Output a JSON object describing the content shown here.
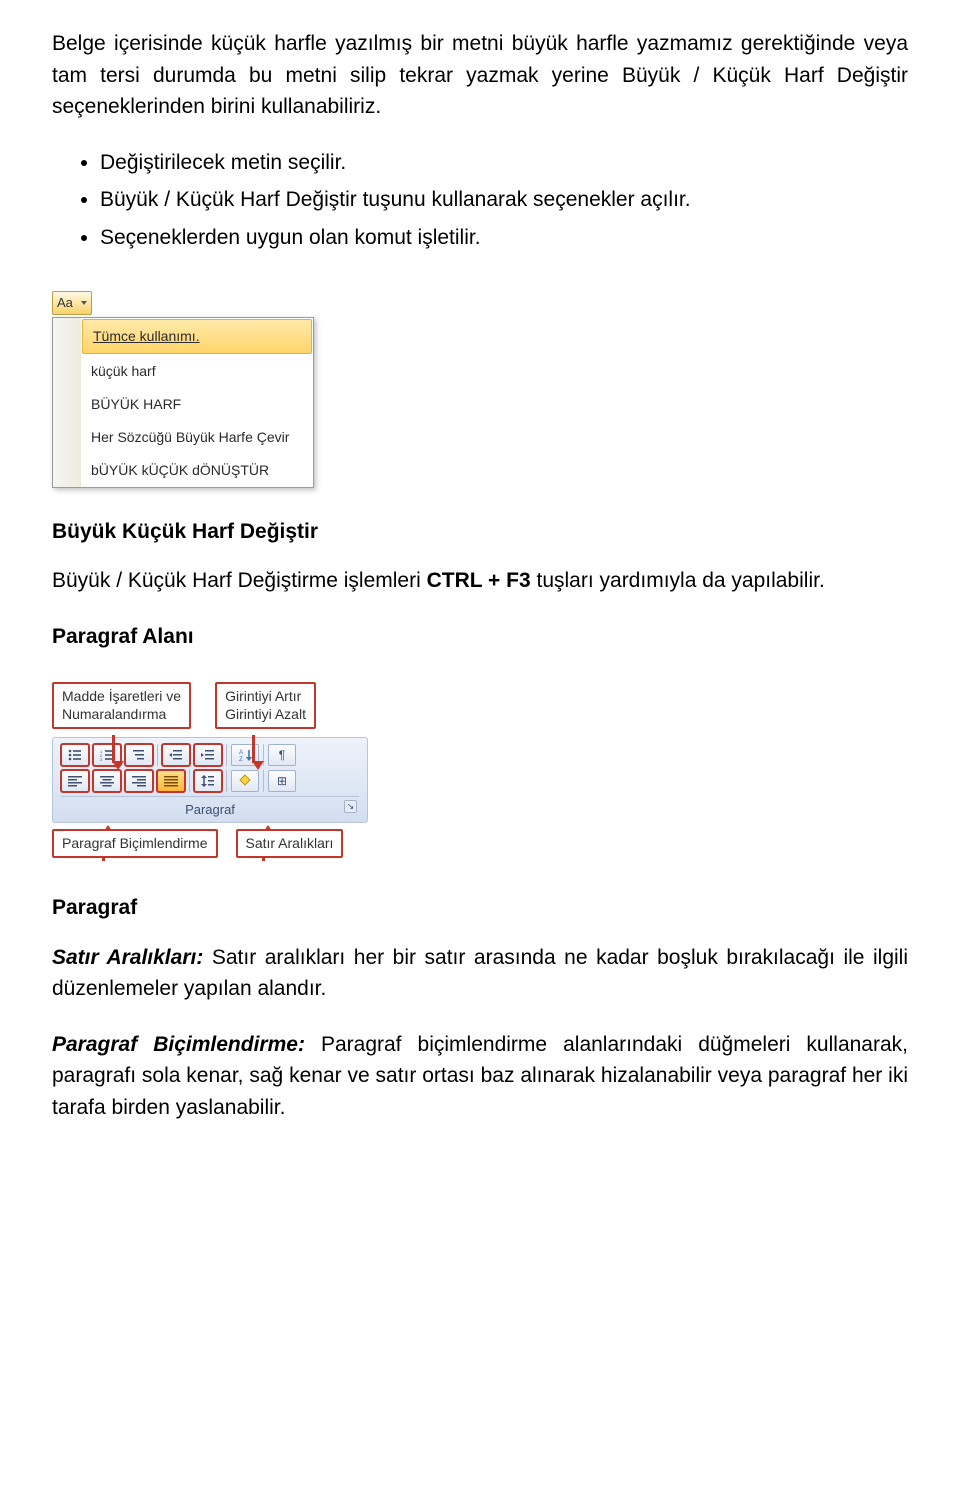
{
  "intro": "Belge içerisinde küçük harfle yazılmış bir metni büyük harfle yazmamız gerektiğinde veya tam tersi durumda bu metni silip tekrar yazmak yerine Büyük / Küçük Harf Değiştir seçeneklerinden birini kullanabiliriz.",
  "steps": [
    "Değiştirilecek metin seçilir.",
    "Büyük / Küçük Harf Değiştir tuşunu kullanarak seçenekler açılır.",
    "Seçeneklerden uygun olan komut işletilir."
  ],
  "dropdown": {
    "button_label": "Aa",
    "items": [
      {
        "label": "Tümce kullanımı.",
        "underline_index": 0,
        "highlight": true
      },
      {
        "label": "küçük harf",
        "underline_index": 0,
        "highlight": false
      },
      {
        "label": "BÜYÜK HARF",
        "underline_index": 0,
        "highlight": false
      },
      {
        "label": "Her Sözcüğü Büyük Harfe Çevir",
        "underline_index": 0,
        "highlight": false
      },
      {
        "label": "bÜYÜK kÜÇÜK dÖNÜŞTÜR",
        "underline_index": 12,
        "highlight": false
      }
    ]
  },
  "heading1": "Büyük Küçük Harf Değiştir",
  "shortcut_pre": "Büyük / Küçük Harf Değiştirme işlemleri ",
  "shortcut_bold": "CTRL + F3",
  "shortcut_post": " tuşları yardımıyla da yapılabilir.",
  "heading2": "Paragraf Alanı",
  "callout_top_left_line1": "Madde İşaretleri ve",
  "callout_top_left_line2": "Numaralandırma",
  "callout_top_right_line1": "Girintiyi Artır",
  "callout_top_right_line2": "Girintiyi Azalt",
  "ribbon_label": "Paragraf",
  "callout_bottom_left": "Paragraf Biçimlendirme",
  "callout_bottom_right": "Satır Aralıkları",
  "heading3": "Paragraf",
  "para_spacing_label": "Satır Aralıkları:",
  "para_spacing_text": " Satır aralıkları her bir satır arasında ne kadar boşluk bırakılacağı ile ilgili düzenlemeler yapılan alandır.",
  "para_format_label": "Paragraf Biçimlendirme:",
  "para_format_text": " Paragraf biçimlendirme alanlarındaki düğmeleri kullanarak, paragrafı sola kenar, sağ kenar ve satır ortası baz alınarak hizalanabilir veya paragraf her iki tarafa birden yaslanabilir.",
  "icons": {
    "sort_label": "A↓Z",
    "pilcrow": "¶",
    "border": "⊞"
  }
}
